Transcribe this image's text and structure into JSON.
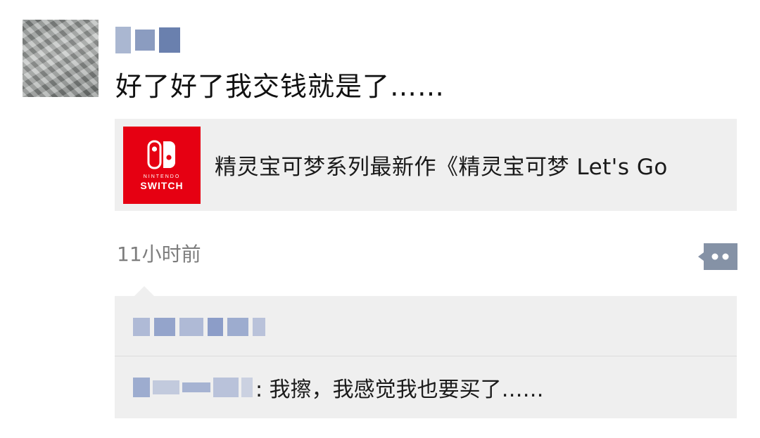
{
  "post": {
    "text": "好了好了我交钱就是了……",
    "share": {
      "title": "精灵宝可梦系列最新作《精灵宝可梦 Let's Go",
      "thumb_brand_small": "NINTENDO",
      "thumb_brand_big": "SWITCH",
      "thumb_color": "#e60012"
    },
    "timestamp": "11小时前"
  },
  "comments": [
    {
      "text": ": 我擦，我感觉我也要买了……"
    }
  ],
  "icons": {
    "comment_button": "more-dots-icon",
    "share_logo": "nintendo-switch-logo"
  }
}
